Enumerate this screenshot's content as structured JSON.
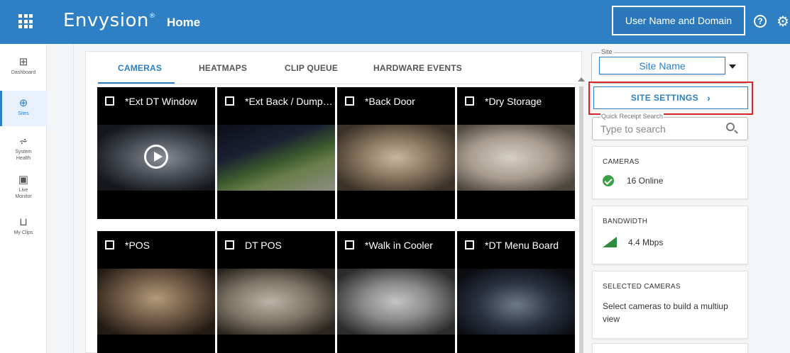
{
  "app": {
    "brand": "Envysion",
    "brand_mark": "®",
    "page_title": "Home"
  },
  "header": {
    "user_button": "User Name and Domain",
    "help_icon_glyph": "?",
    "settings_icon_glyph": "⚙"
  },
  "sidebar": {
    "items": [
      {
        "label": "Dashboard",
        "icon": "dashboard-icon",
        "glyph": "⊞",
        "active": false
      },
      {
        "label": "Sites",
        "icon": "globe-icon",
        "glyph": "⊕",
        "active": true
      },
      {
        "label": "System Health",
        "label_line1": "System",
        "label_line2": "Health",
        "icon": "health-icon",
        "glyph": "⩫",
        "active": false
      },
      {
        "label": "Live Monitor",
        "label_line1": "Live",
        "label_line2": "Monitor",
        "icon": "monitor-icon",
        "glyph": "▣",
        "active": false
      },
      {
        "label": "My Clips",
        "icon": "clips-icon",
        "glyph": "⊔",
        "active": false
      }
    ]
  },
  "tabs": [
    {
      "label": "CAMERAS",
      "active": true
    },
    {
      "label": "HEATMAPS",
      "active": false
    },
    {
      "label": "CLIP QUEUE",
      "active": false
    },
    {
      "label": "HARDWARE EVENTS",
      "active": false
    }
  ],
  "cameras": [
    {
      "name": "*Ext DT Window",
      "playing_overlay": true
    },
    {
      "name": "*Ext Back / Dumpster",
      "playing_overlay": false
    },
    {
      "name": "*Back Door",
      "playing_overlay": false
    },
    {
      "name": "*Dry Storage",
      "playing_overlay": false
    },
    {
      "name": "*POS",
      "playing_overlay": false
    },
    {
      "name": "DT POS",
      "playing_overlay": false
    },
    {
      "name": "*Walk in Cooler",
      "playing_overlay": false
    },
    {
      "name": "*DT Menu Board",
      "playing_overlay": false
    }
  ],
  "site": {
    "legend": "Site",
    "name": "Site Name"
  },
  "site_settings": {
    "label": "SITE SETTINGS",
    "chevron": "›"
  },
  "quick_receipt": {
    "label": "Quick Receipt Search",
    "placeholder": "Type to search"
  },
  "cards": {
    "cameras": {
      "title": "CAMERAS",
      "value": "16 Online"
    },
    "bandwidth": {
      "title": "BANDWIDTH",
      "value": "4.4 Mbps"
    },
    "selected": {
      "title": "SELECTED CAMERAS",
      "text": "Select cameras to build a multiup view"
    }
  },
  "colors": {
    "primary": "#2e7fc3",
    "highlight_border": "#d9262b",
    "online": "#3aa047",
    "signal": "#2e8b3e"
  }
}
